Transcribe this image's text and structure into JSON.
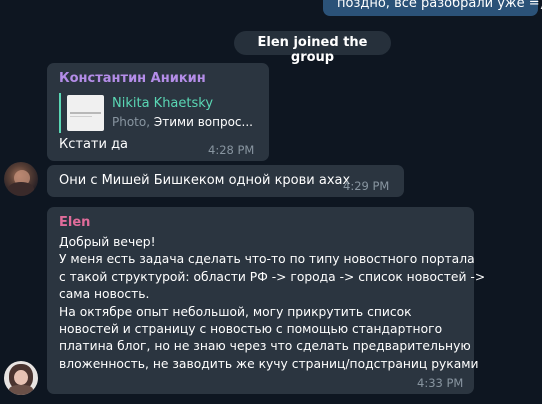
{
  "colors": {
    "background": "#0e1621",
    "bubble": "#2b3540",
    "konstantin_name": "#b48de8",
    "reply_accent": "#5ad7b4",
    "elen_name": "#e06c9a",
    "meta_text": "#8895a0"
  },
  "top_message": {
    "text": "поздно, все разобрали уже =)"
  },
  "system_message": {
    "text": "Elen joined the group"
  },
  "messages": [
    {
      "sender": "Константин Аникин",
      "reply": {
        "author": "Nikita Khaetsky",
        "type_label": "Photo,",
        "preview": "Этими вопрос..."
      },
      "text": "Кстати да",
      "time": "4:28 PM"
    },
    {
      "text": "Они с Мишей Бишкеком одной крови ахах",
      "time": "4:29 PM"
    },
    {
      "sender": "Elen",
      "lines": [
        "Добрый вечер!",
        "У меня есть задача сделать что-то по типу новостного портала",
        "с такой структурой: области РФ -> города -> список новостей ->",
        "сама новость.",
        "На октябре опыт небольшой, могу прикрутить список",
        "новостей и страницу с новостью с помощью стандартного",
        "платина блог,  но не знаю через что сделать предварительную",
        "вложенность, не заводить же кучу страниц/подстраниц руками"
      ],
      "time": "4:33 PM"
    }
  ]
}
